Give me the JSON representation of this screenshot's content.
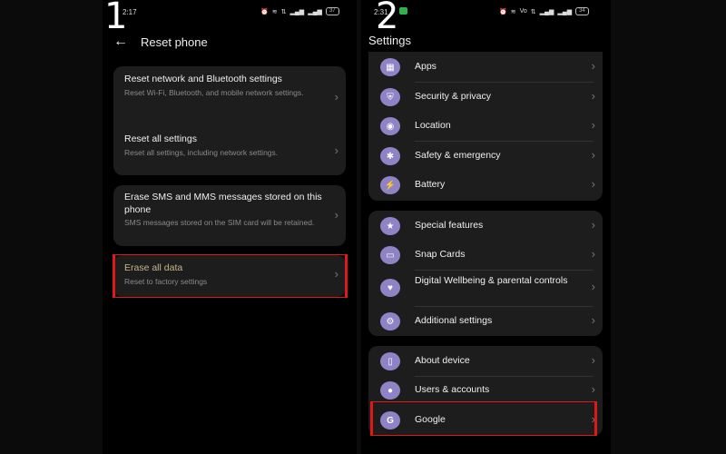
{
  "phone1": {
    "step": "1",
    "status": {
      "time": "2:17",
      "icons": [
        "alarm-icon",
        "wifi-icon",
        "data-icon",
        "signal-icon",
        "signal-icon"
      ],
      "battery": "37"
    },
    "header": {
      "back_icon": "arrow-left-icon",
      "title": "Reset phone"
    },
    "items": [
      {
        "title": "Reset network and Bluetooth settings",
        "subtitle": "Reset Wi-Fi, Bluetooth, and mobile network settings."
      },
      {
        "title": "Reset all settings",
        "subtitle": "Reset all settings, including network settings."
      },
      {
        "title": "Erase SMS and MMS messages stored on this phone",
        "subtitle": "SMS messages stored on the SIM card will be retained."
      },
      {
        "title": "Erase all data",
        "subtitle": "Reset to factory settings",
        "highlighted": true
      }
    ]
  },
  "phone2": {
    "step": "2",
    "status": {
      "time": "2:31",
      "icons": [
        "alarm-icon",
        "wifi-icon",
        "volte-icon",
        "data-icon",
        "signal-icon",
        "signal-icon"
      ],
      "battery": "34"
    },
    "title": "Settings",
    "groups": [
      [
        {
          "label": "Apps",
          "icon": "apps-icon"
        },
        {
          "label": "Security & privacy",
          "icon": "shield-icon"
        },
        {
          "label": "Location",
          "icon": "location-icon"
        },
        {
          "label": "Safety & emergency",
          "icon": "asterisk-icon"
        },
        {
          "label": "Battery",
          "icon": "battery-icon"
        }
      ],
      [
        {
          "label": "Special features",
          "icon": "star-icon"
        },
        {
          "label": "Snap Cards",
          "icon": "card-icon"
        },
        {
          "label": "Digital Wellbeing & parental controls",
          "icon": "wellbeing-icon"
        },
        {
          "label": "Additional settings",
          "icon": "gear-icon"
        }
      ],
      [
        {
          "label": "About device",
          "icon": "device-icon"
        },
        {
          "label": "Users & accounts",
          "icon": "user-icon"
        },
        {
          "label": "Google",
          "icon": "google-icon",
          "highlighted": true
        }
      ]
    ]
  },
  "colors": {
    "highlight": "#e01818",
    "icon_bg": "#8f83c5",
    "erase_title": "#c9b48a"
  }
}
